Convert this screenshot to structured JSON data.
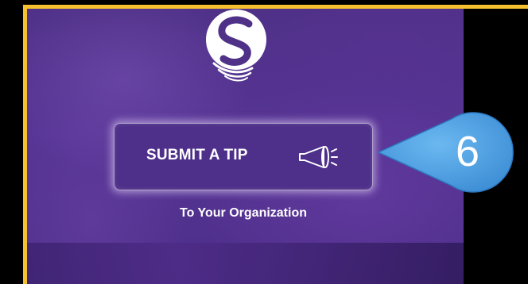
{
  "tip_button": {
    "label": "SUBMIT A TIP"
  },
  "sub_label": "To Your Organization",
  "callout": {
    "number": "6"
  },
  "icons": {
    "logo": "brand-s-logo-icon",
    "megaphone": "megaphone-icon"
  },
  "colors": {
    "frame_border": "#f5c12e",
    "panel_purple": "#4f3188",
    "callout_blue": "#56a8e8",
    "text": "#ffffff"
  }
}
